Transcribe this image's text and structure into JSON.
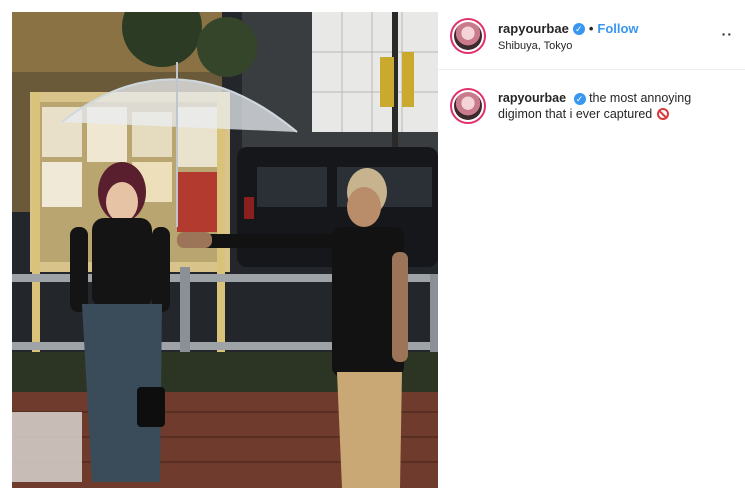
{
  "post": {
    "username": "rapyourbae",
    "verified_glyph": "✓",
    "separator": "•",
    "follow_label": "Follow",
    "location": "Shibuya, Tokyo",
    "more_label": "··",
    "caption_username": "rapyourbae",
    "caption_text": " the most annoying digimon that i ever captured",
    "caption_emoji_icon": "no-entry-icon"
  },
  "colors": {
    "link_blue": "#3897f0",
    "story_ring": "#e1306c",
    "prohibited_red": "#d93a3a"
  }
}
